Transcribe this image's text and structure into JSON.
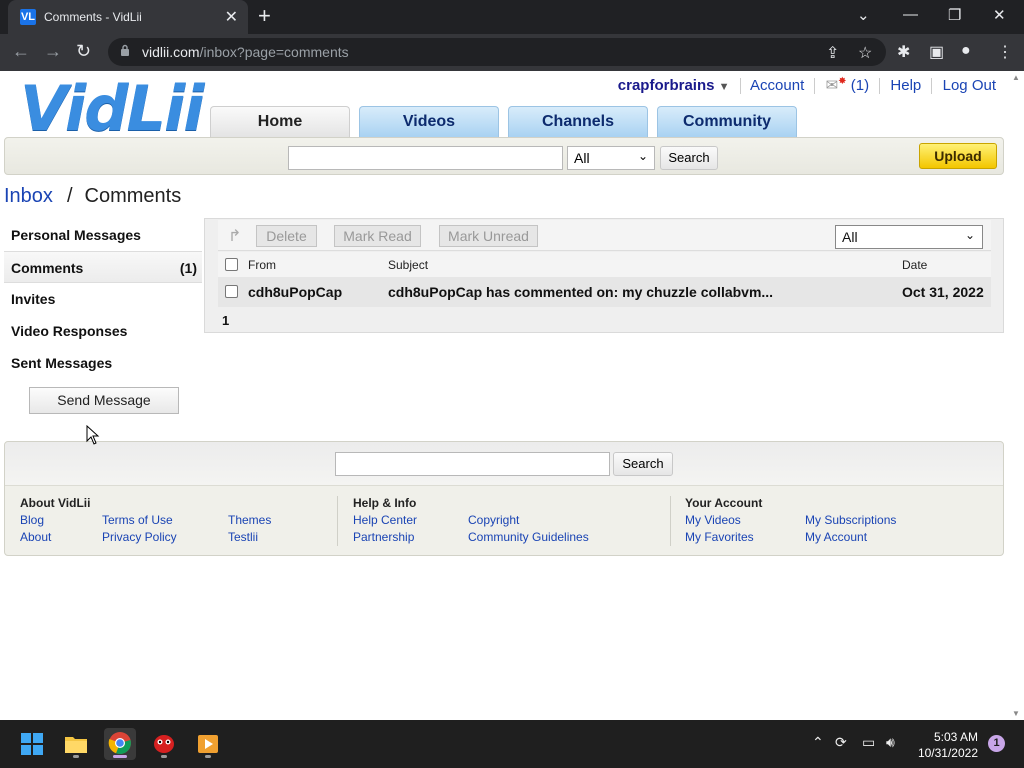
{
  "browser": {
    "tab_title": "Comments - VidLii",
    "favicon_text": "VL",
    "close_tab": "✕",
    "new_tab": "+",
    "url_host": "vidlii.com",
    "url_path": "/inbox?page=comments"
  },
  "header": {
    "logo": "VidLii",
    "username": "crapforbrains",
    "account": "Account",
    "inbox_count": "(1)",
    "help": "Help",
    "logout": "Log Out",
    "nav": [
      "Home",
      "Videos",
      "Channels",
      "Community"
    ]
  },
  "search": {
    "value": "",
    "filter": "All",
    "button": "Search",
    "upload": "Upload"
  },
  "breadcrumb": {
    "parent": "Inbox",
    "separator": "/",
    "current": "Comments"
  },
  "sidebar": {
    "items": [
      {
        "label": "Personal Messages",
        "count": ""
      },
      {
        "label": "Comments",
        "count": "(1)"
      },
      {
        "label": "Invites",
        "count": ""
      },
      {
        "label": "Video Responses",
        "count": ""
      },
      {
        "label": "Sent Messages",
        "count": ""
      }
    ],
    "send_button": "Send Message"
  },
  "messages": {
    "toolbar": {
      "delete": "Delete",
      "mark_read": "Mark Read",
      "mark_unread": "Mark Unread",
      "filter": "All"
    },
    "columns": {
      "from": "From",
      "subject": "Subject",
      "date": "Date"
    },
    "rows": [
      {
        "from": "cdh8uPopCap",
        "subject": "cdh8uPopCap has commented on: my chuzzle collabvm...",
        "date": "Oct 31, 2022"
      }
    ],
    "page": "1"
  },
  "footer": {
    "search_value": "",
    "search_button": "Search",
    "sections": [
      {
        "title": "About VidLii",
        "links": [
          "Blog",
          "Terms of Use",
          "Themes",
          "About",
          "Privacy Policy",
          "Testlii"
        ]
      },
      {
        "title": "Help & Info",
        "links": [
          "Help Center",
          "Copyright",
          "Partnership",
          "Community Guidelines"
        ]
      },
      {
        "title": "Your Account",
        "links": [
          "My Videos",
          "My Subscriptions",
          "My Favorites",
          "My Account"
        ]
      }
    ]
  },
  "taskbar": {
    "time": "5:03 AM",
    "date": "10/31/2022",
    "notifications": "1"
  },
  "colors": {
    "link": "#1a44b4",
    "logo": "#3a8de0",
    "upload": "#f3c600",
    "nav_tab": "#a9d2f2"
  }
}
